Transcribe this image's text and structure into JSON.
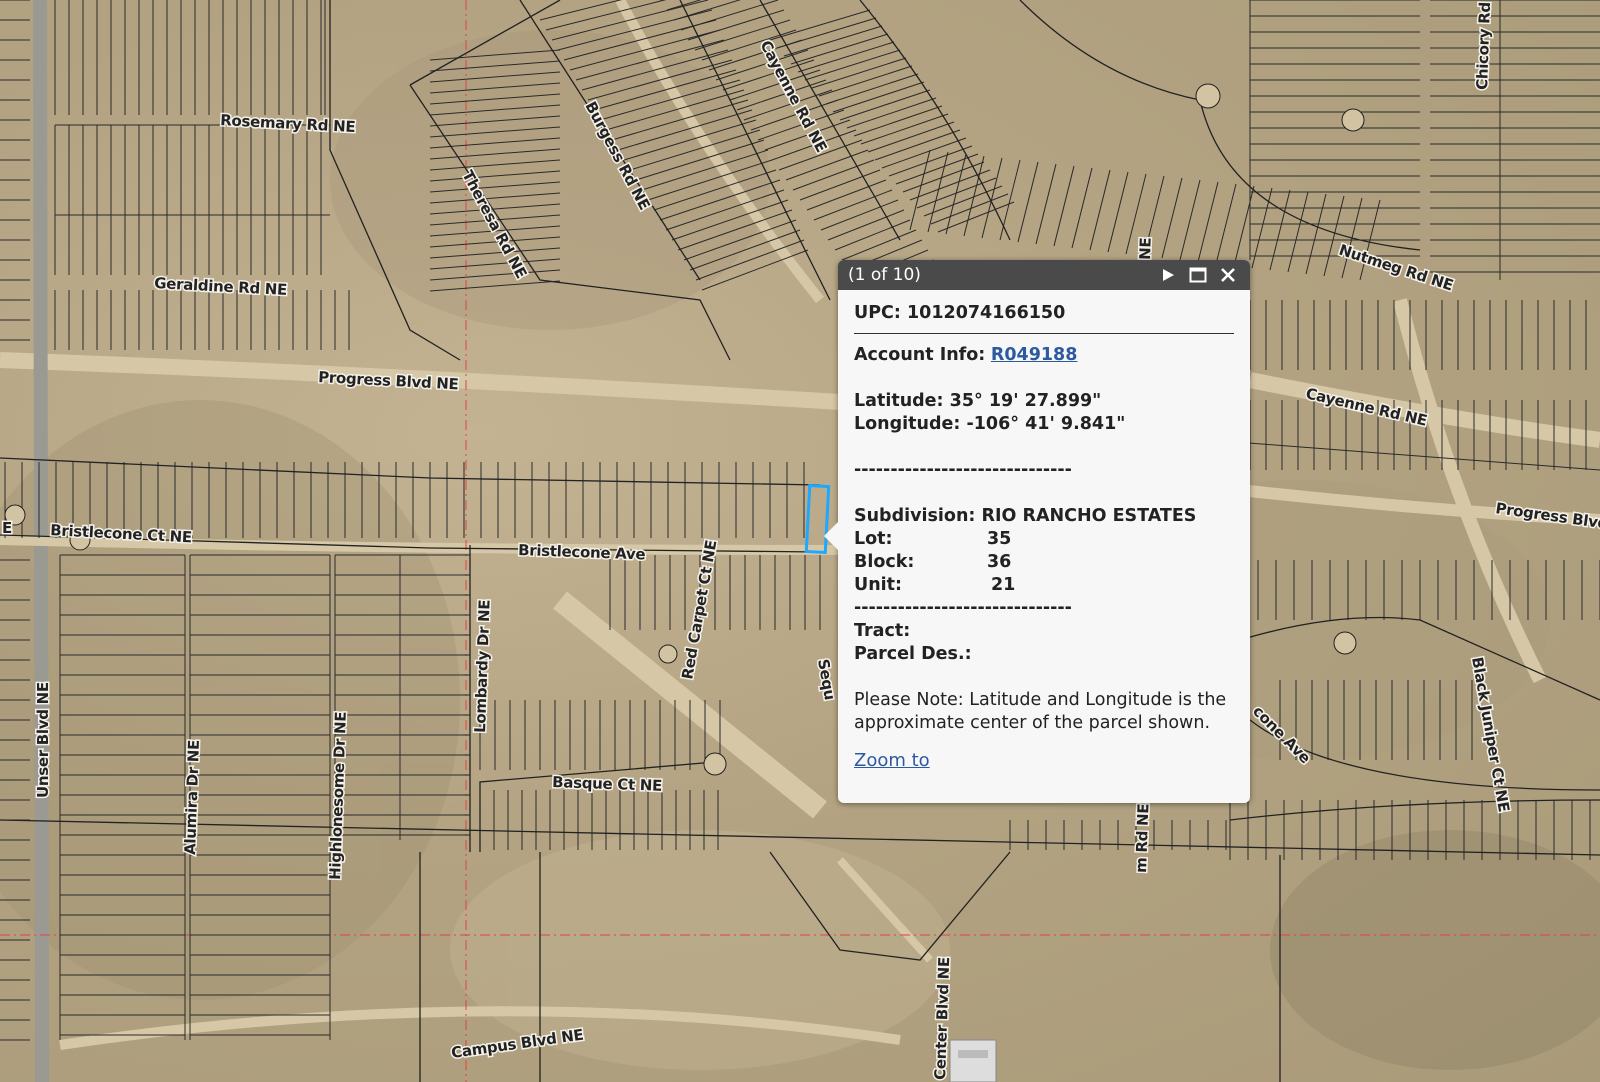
{
  "map": {
    "roads": [
      "Rosemary Rd NE",
      "Geraldine Rd NE",
      "Progress Blvd NE",
      "Bristlecone Ct NE",
      "Bristlecone Ave",
      "Burgess Rd NE",
      "Theresa Rd NE",
      "Cayenne Rd NE",
      "Nutmeg Rd NE",
      "Cayenne Rd NE",
      "Progress Blvd",
      "Chicory Rd",
      "Red Carpet Ct NE",
      "Lombardy Dr NE",
      "Basque Ct NE",
      "Unser Blvd NE",
      "Alumira Dr NE",
      "Highlonesome Dr NE",
      "Campus Blvd NE",
      "Black Juniper Ct NE",
      "cone Ave",
      "Sequ",
      "NE",
      "m Rd NE",
      "Center Blvd NE",
      "E"
    ]
  },
  "popup": {
    "counter": "(1 of 10)",
    "upc_label": "UPC:",
    "upc_value": "1012074166150",
    "account_label": "Account Info:",
    "account_value": "R049188",
    "latitude_label": "Latitude:",
    "latitude_value": "35° 19' 27.899\"",
    "longitude_label": "Longitude:",
    "longitude_value": "-106° 41' 9.841\"",
    "separator": "------------------------------",
    "subdivision_label": "Subdivision:",
    "subdivision_value": "RIO RANCHO ESTATES",
    "lot_label": "Lot:",
    "lot_value": "35",
    "block_label": "Block:",
    "block_value": "36",
    "unit_label": "Unit:",
    "unit_value": "21",
    "tract_label": "Tract:",
    "parcel_label": "Parcel Des.:",
    "note": "Please Note: Latitude and Longitude is the approximate center of the parcel shown.",
    "zoom_link": "Zoom to",
    "icons": [
      "play-icon",
      "maximize-icon",
      "close-icon"
    ]
  },
  "colors": {
    "header_bg": "#4a4a4a",
    "link": "#2c5aa0",
    "selected_parcel": "#1ea8ff",
    "parcel_lines": "#2a2a2a"
  }
}
